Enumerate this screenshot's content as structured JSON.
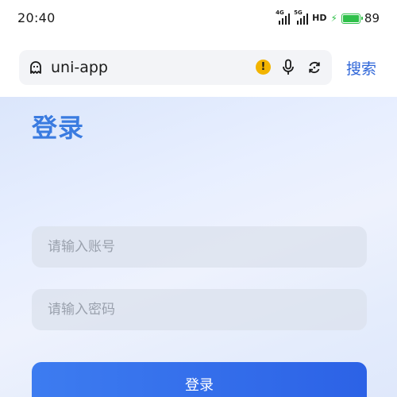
{
  "status_bar": {
    "time": "20:40",
    "signal_1_tag": "4G",
    "signal_2_tag": "5G",
    "network_label": "HD",
    "battery_level": "89",
    "battery_color": "#2fc04a"
  },
  "browser": {
    "url": "uni-app",
    "search_label": "搜索",
    "accent_color": "#2f66d8",
    "icons": [
      "ghost-icon",
      "warning-icon",
      "microphone-icon",
      "refresh-icon"
    ]
  },
  "login": {
    "title": "登录",
    "account_placeholder": "请输入账号",
    "password_placeholder": "请输入密码",
    "submit_label": "登录",
    "title_color": "#3a7be0",
    "button_color": "#2f6ae8"
  }
}
